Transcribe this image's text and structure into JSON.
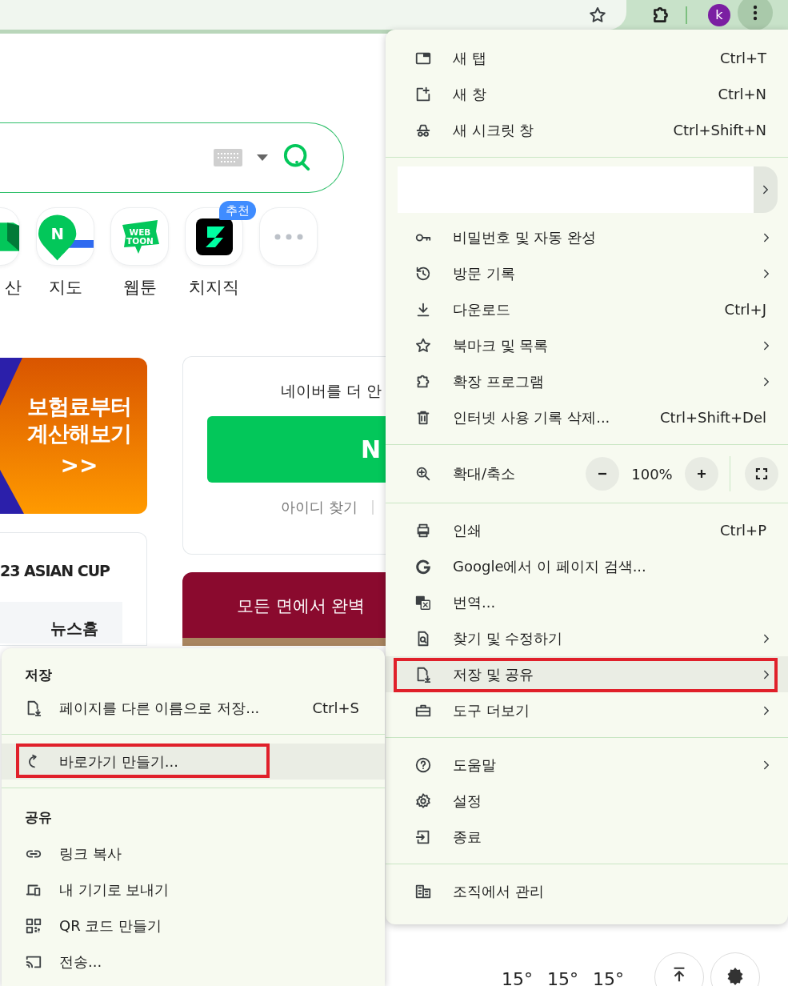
{
  "toolbar": {
    "avatar_letter": "k"
  },
  "page": {
    "shortcuts": [
      {
        "kind": "partial",
        "label": "산"
      },
      {
        "kind": "map",
        "label": "지도",
        "logo_text": [
          "N"
        ]
      },
      {
        "kind": "webtoon",
        "label": "웹툰",
        "logo_text": [
          "WEB",
          "TOON"
        ]
      },
      {
        "kind": "chzzk",
        "label": "치지직",
        "badge": "추천"
      },
      {
        "kind": "more"
      }
    ],
    "banner": {
      "lines": [
        "보험료부터",
        "계산해보기"
      ],
      "arrow": ">>"
    },
    "news_card": {
      "title": "23 ASIAN CUP",
      "tab": "뉴스홈"
    },
    "login_card": {
      "prompt": "네이버를 더 안",
      "button": "N",
      "link": "아이디 찾기"
    },
    "ad": {
      "text": "모든 면에서 완벽"
    },
    "weather": {
      "temps": [
        "15°",
        "15°",
        "15°"
      ]
    }
  },
  "main_menu": {
    "items": [
      {
        "kind": "item",
        "label": "새 탭",
        "shortcut": "Ctrl+T",
        "submenu": false,
        "highlighted": false,
        "annotated": false
      },
      {
        "kind": "item",
        "label": "새 창",
        "shortcut": "Ctrl+N",
        "submenu": false,
        "highlighted": false,
        "annotated": false
      },
      {
        "kind": "item",
        "label": "새 시크릿 창",
        "shortcut": "Ctrl+Shift+N",
        "submenu": false,
        "highlighted": false,
        "annotated": false
      },
      {
        "kind": "divider"
      },
      {
        "kind": "profile"
      },
      {
        "kind": "item",
        "label": "비밀번호 및 자동 완성",
        "submenu": true,
        "highlighted": false,
        "annotated": false
      },
      {
        "kind": "item",
        "label": "방문 기록",
        "submenu": true,
        "highlighted": false,
        "annotated": false
      },
      {
        "kind": "item",
        "label": "다운로드",
        "shortcut": "Ctrl+J",
        "submenu": false,
        "highlighted": false,
        "annotated": false
      },
      {
        "kind": "item",
        "label": "북마크 및 목록",
        "submenu": true,
        "highlighted": false,
        "annotated": false
      },
      {
        "kind": "item",
        "label": "확장 프로그램",
        "submenu": true,
        "highlighted": false,
        "annotated": false
      },
      {
        "kind": "item",
        "label": "인터넷 사용 기록 삭제...",
        "shortcut": "Ctrl+Shift+Del",
        "submenu": false,
        "highlighted": false,
        "annotated": false
      },
      {
        "kind": "divider"
      },
      {
        "kind": "zoom",
        "label": "확대/축소",
        "value": "100%"
      },
      {
        "kind": "divider"
      },
      {
        "kind": "item",
        "label": "인쇄",
        "shortcut": "Ctrl+P",
        "submenu": false,
        "highlighted": false,
        "annotated": false
      },
      {
        "kind": "item",
        "label": "Google에서 이 페이지 검색...",
        "submenu": false,
        "highlighted": false,
        "annotated": false
      },
      {
        "kind": "item",
        "label": "번역...",
        "submenu": false,
        "highlighted": false,
        "annotated": false
      },
      {
        "kind": "item",
        "label": "찾기 및 수정하기",
        "submenu": true,
        "highlighted": false,
        "annotated": false
      },
      {
        "kind": "item",
        "label": "저장 및 공유",
        "submenu": true,
        "highlighted": true,
        "annotated": true
      },
      {
        "kind": "item",
        "label": "도구 더보기",
        "submenu": true,
        "highlighted": false,
        "annotated": false
      },
      {
        "kind": "divider"
      },
      {
        "kind": "item",
        "label": "도움말",
        "submenu": true,
        "highlighted": false,
        "annotated": false
      },
      {
        "kind": "item",
        "label": "설정",
        "submenu": false,
        "highlighted": false,
        "annotated": false
      },
      {
        "kind": "item",
        "label": "종료",
        "submenu": false,
        "highlighted": false,
        "annotated": false
      },
      {
        "kind": "divider"
      },
      {
        "kind": "item",
        "label": "조직에서 관리",
        "submenu": false,
        "highlighted": false,
        "annotated": false
      }
    ]
  },
  "submenu": {
    "items": [
      {
        "kind": "header",
        "label": "저장"
      },
      {
        "kind": "item",
        "label": "페이지를 다른 이름으로 저장...",
        "shortcut": "Ctrl+S",
        "submenu": false,
        "highlighted": false,
        "annotated": false
      },
      {
        "kind": "divider"
      },
      {
        "kind": "item",
        "label": "바로가기 만들기...",
        "submenu": false,
        "highlighted": true,
        "annotated": true
      },
      {
        "kind": "divider"
      },
      {
        "kind": "header",
        "label": "공유"
      },
      {
        "kind": "item",
        "label": "링크 복사",
        "submenu": false,
        "highlighted": false,
        "annotated": false
      },
      {
        "kind": "item",
        "label": "내 기기로 보내기",
        "submenu": false,
        "highlighted": false,
        "annotated": false
      },
      {
        "kind": "item",
        "label": "QR 코드 만들기",
        "submenu": false,
        "highlighted": false,
        "annotated": false
      },
      {
        "kind": "item",
        "label": "전송...",
        "submenu": false,
        "highlighted": false,
        "annotated": false
      }
    ]
  }
}
